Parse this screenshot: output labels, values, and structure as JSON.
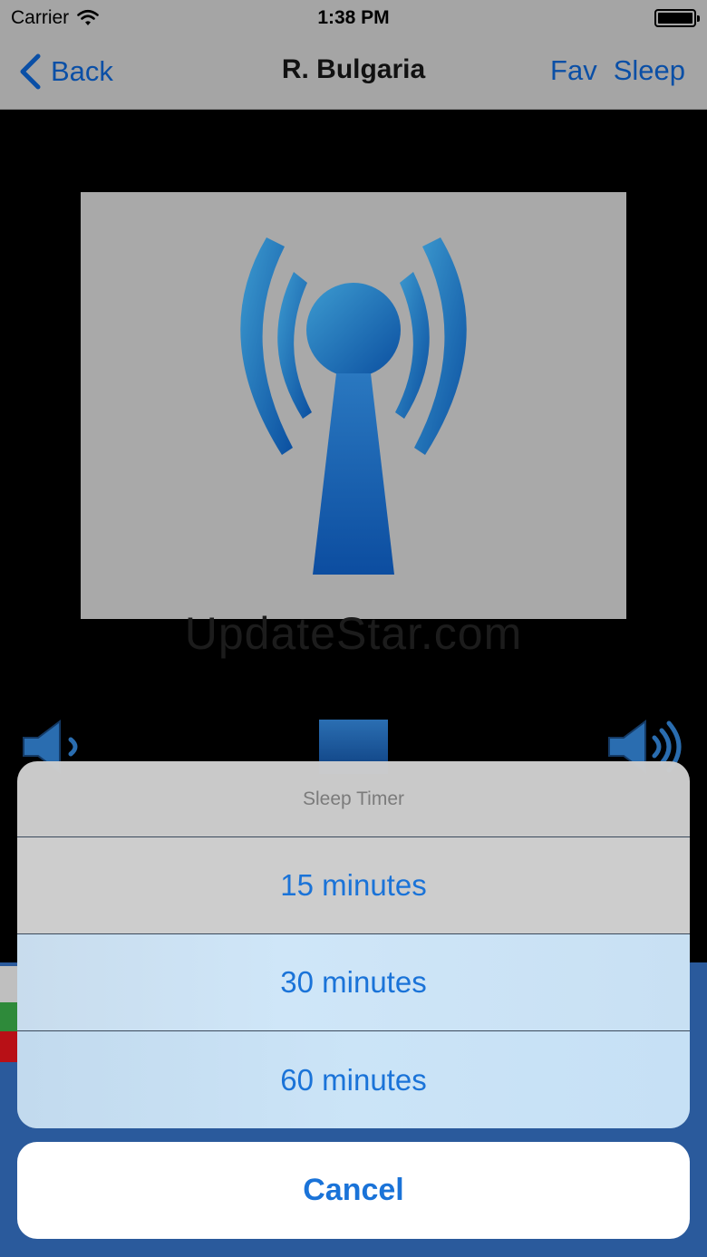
{
  "status_bar": {
    "carrier": "Carrier",
    "time": "1:38 PM",
    "wifi_icon": "wifi-icon",
    "battery_icon": "battery-icon"
  },
  "nav": {
    "back_label": "Back",
    "title": "R. Bulgaria",
    "fav_label": "Fav",
    "sleep_label": "Sleep",
    "accent_color": "#0a4fa6"
  },
  "player": {
    "artwork_icon": "radio-tower-icon",
    "watermark": "UpdateStar.com",
    "volume_down_icon": "volume-low-icon",
    "volume_up_icon": "volume-high-icon",
    "stop_icon": "stop-icon"
  },
  "action_sheet": {
    "title": "Sleep Timer",
    "options": [
      {
        "label": "15 minutes"
      },
      {
        "label": "30 minutes"
      },
      {
        "label": "60 minutes"
      }
    ],
    "cancel_label": "Cancel",
    "option_color": "#1a73d8"
  }
}
